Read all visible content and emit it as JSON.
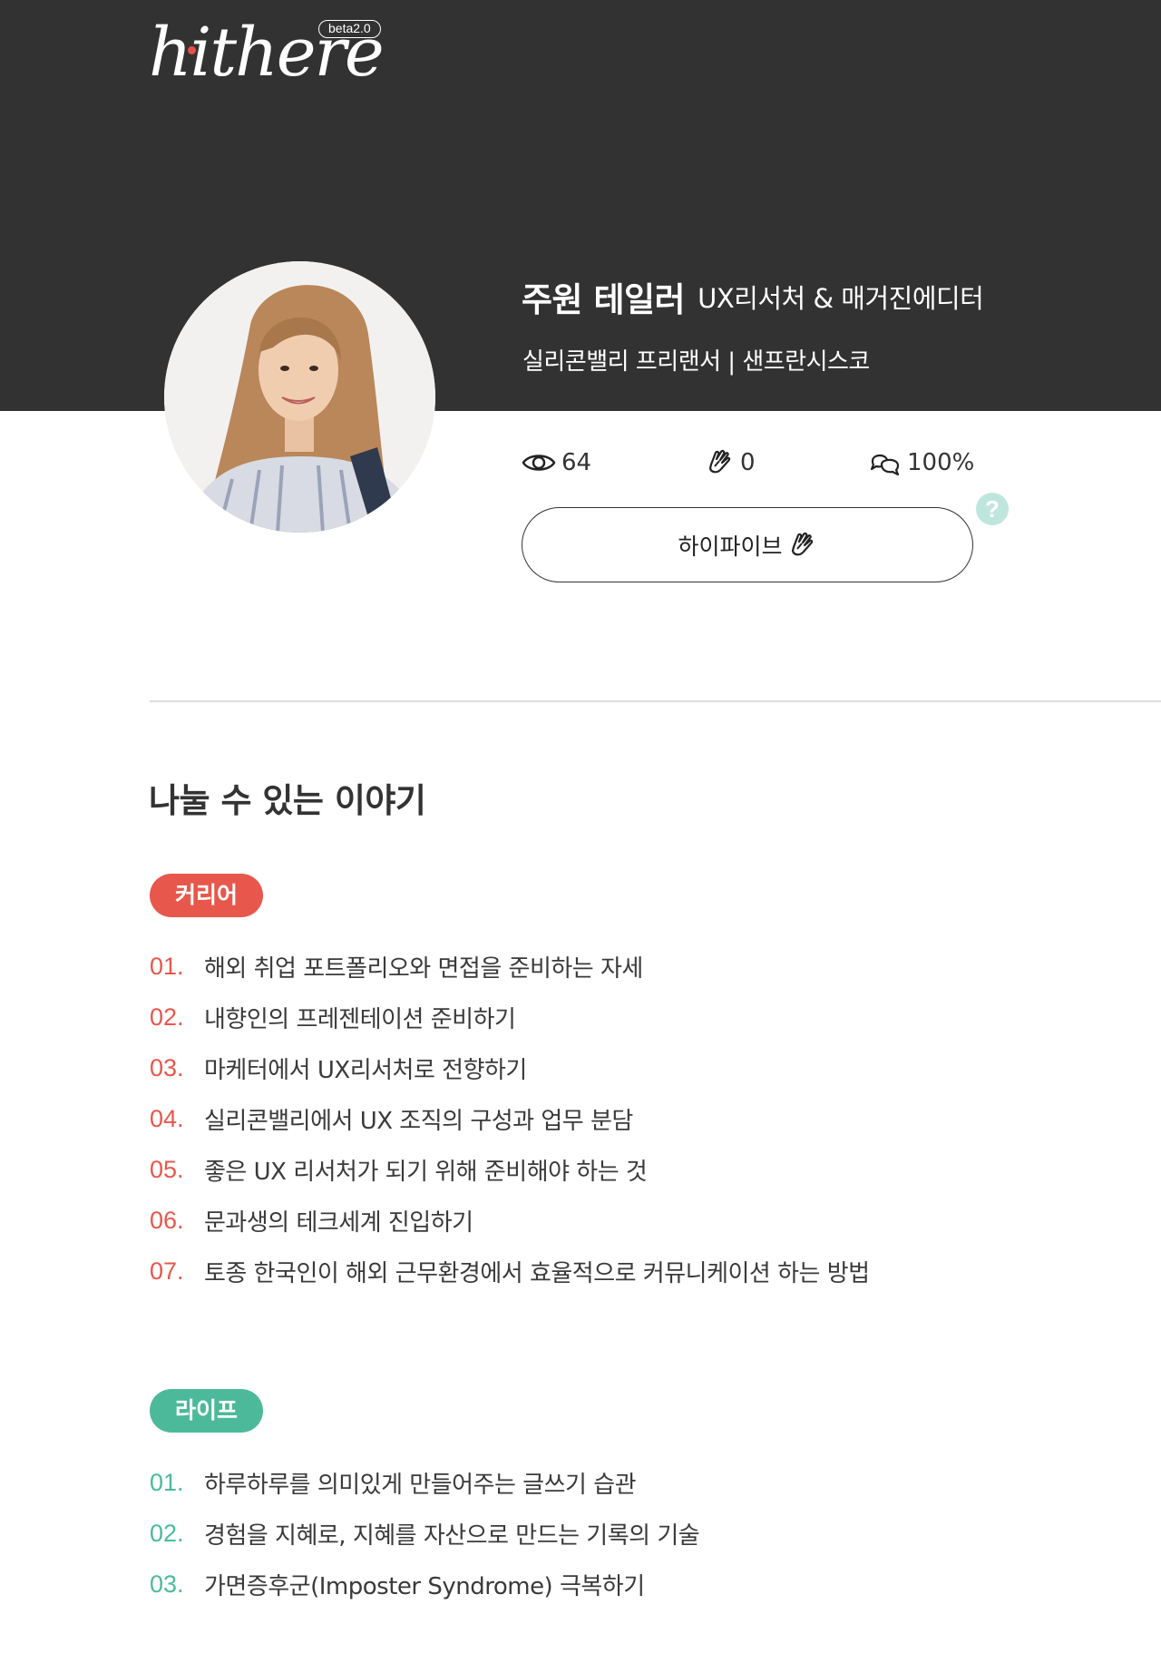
{
  "brand": {
    "logo_text": "hithere",
    "beta_label": "beta2.0"
  },
  "profile": {
    "name": "주원 테일러",
    "role": "UX리서처 & 매거진에디터",
    "location": "실리콘밸리 프리랜서 | 샌프란시스코",
    "stats": {
      "views": "64",
      "hifives": "0",
      "reply_rate": "100%"
    },
    "hifive_button_label": "하이파이브",
    "help_label": "?"
  },
  "section_title": "나눌 수 있는 이야기",
  "categories": [
    {
      "label": "커리어",
      "color": "#e8574c",
      "items": [
        {
          "num": "01.",
          "text": "해외 취업 포트폴리오와 면접을 준비하는 자세"
        },
        {
          "num": "02.",
          "text": "내향인의 프레젠테이션 준비하기"
        },
        {
          "num": "03.",
          "text": "마케터에서 UX리서처로 전향하기"
        },
        {
          "num": "04.",
          "text": "실리콘밸리에서 UX 조직의 구성과 업무 분담"
        },
        {
          "num": "05.",
          "text": "좋은 UX 리서처가 되기 위해 준비해야 하는 것"
        },
        {
          "num": "06.",
          "text": "문과생의 테크세계 진입하기"
        },
        {
          "num": "07.",
          "text": "토종 한국인이 해외 근무환경에서 효율적으로 커뮤니케이션 하는 방법"
        }
      ]
    },
    {
      "label": "라이프",
      "color": "#4cba9a",
      "items": [
        {
          "num": "01.",
          "text": "하루하루를 의미있게 만들어주는 글쓰기 습관"
        },
        {
          "num": "02.",
          "text": "경험을 지혜로, 지혜를 자산으로 만드는 기록의 기술"
        },
        {
          "num": "03.",
          "text": "가면증후군(Imposter Syndrome) 극복하기"
        }
      ]
    }
  ],
  "colors": {
    "header_bg": "#333232",
    "career_accent": "#e8574c",
    "life_accent": "#4cba9a",
    "help_icon_bg": "#bfe6dd"
  },
  "icons": {
    "views": "eye-icon",
    "hifives": "clapping-hands-icon",
    "reply_rate": "chat-bubbles-icon",
    "help": "question-mark-icon"
  }
}
